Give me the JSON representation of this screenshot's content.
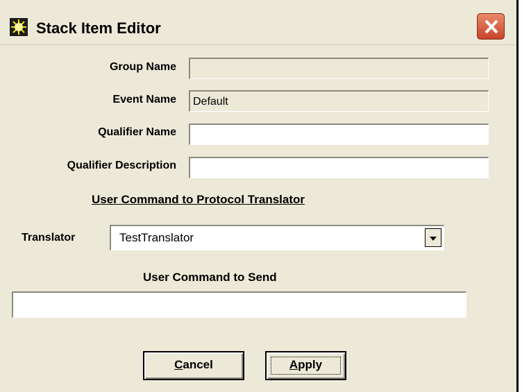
{
  "window": {
    "title": "Stack Item Editor",
    "icon": "app-burst-icon"
  },
  "fields": {
    "group_name": {
      "label": "Group Name",
      "value": ""
    },
    "event_name": {
      "label": "Event Name",
      "value": "Default"
    },
    "qualifier_name": {
      "label": "Qualifier Name",
      "value": ""
    },
    "qualifier_description": {
      "label": "Qualifier Description",
      "value": ""
    }
  },
  "translator_section": {
    "title": "User Command to Protocol Translator",
    "translator_label": "Translator",
    "translator_value": "TestTranslator"
  },
  "command": {
    "label": "User Command to Send",
    "value": ""
  },
  "buttons": {
    "cancel": {
      "accel": "C",
      "rest": "ancel"
    },
    "apply": {
      "accel": "A",
      "rest": "pply"
    }
  },
  "colors": {
    "dialog_bg": "#ece9d8",
    "close_button": "#d3593b"
  }
}
